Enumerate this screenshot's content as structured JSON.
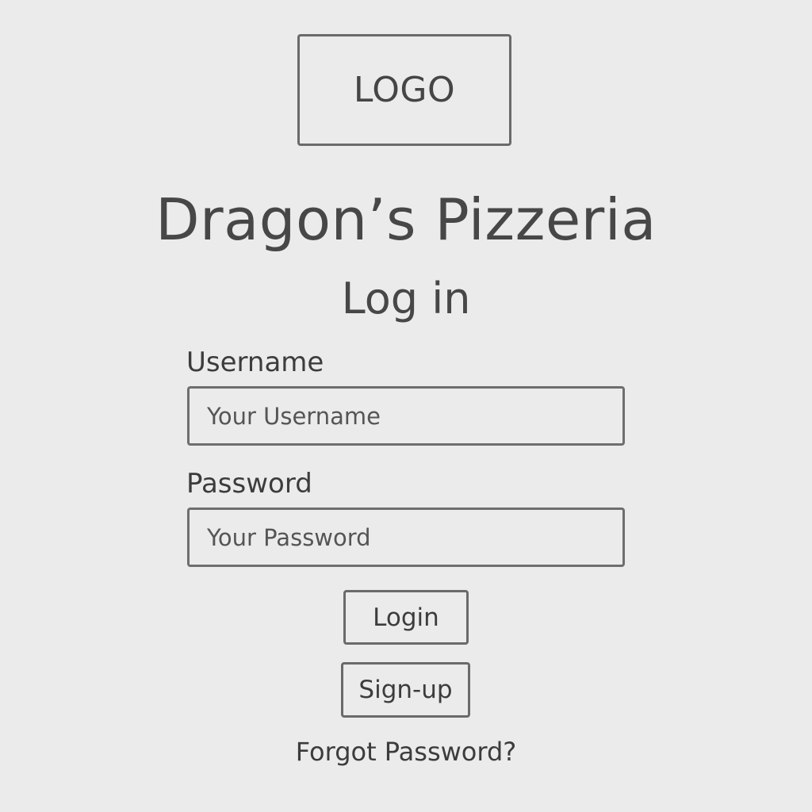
{
  "logo": {
    "text": "LOGO"
  },
  "brand": {
    "title": "Dragon’s Pizzeria"
  },
  "form": {
    "heading": "Log in",
    "username_label": "Username",
    "username_placeholder": "Your Username",
    "password_label": "Password",
    "password_placeholder": "Your Password",
    "login_label": "Login",
    "signup_label": "Sign-up",
    "forgot_label": "Forgot Password?"
  }
}
